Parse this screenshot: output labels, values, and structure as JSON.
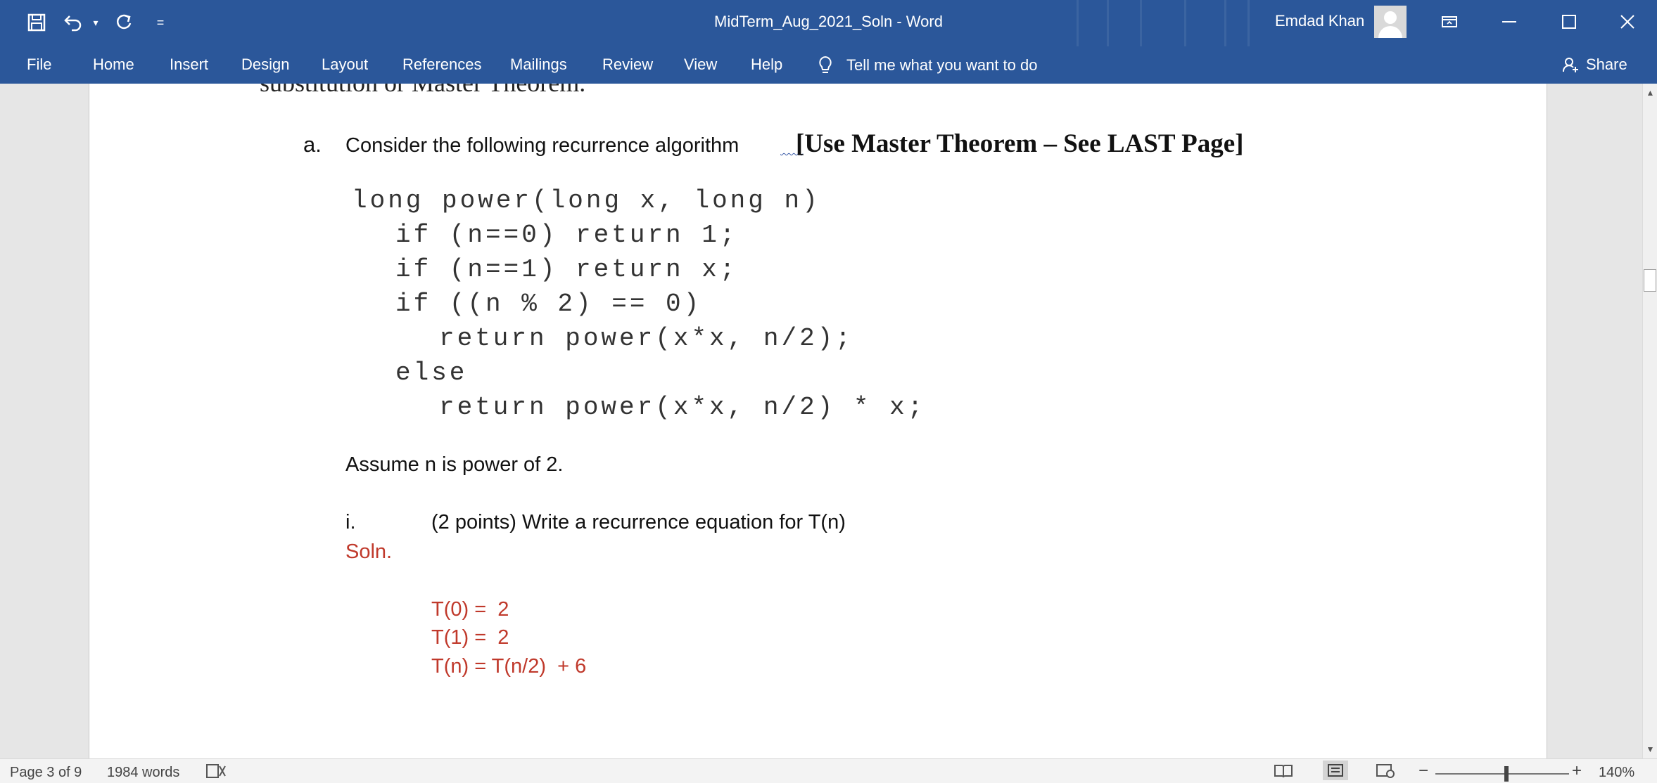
{
  "window": {
    "title": "MidTerm_Aug_2021_Soln  -  Word",
    "user_name": "Emdad Khan",
    "qat_more": "="
  },
  "ribbon": {
    "tabs": [
      "File",
      "Home",
      "Insert",
      "Design",
      "Layout",
      "References",
      "Mailings",
      "Review",
      "View",
      "Help"
    ],
    "tell_me": "Tell me what you want to do",
    "share": "Share"
  },
  "document": {
    "partial_top_line": "substitution or Master Theorem.",
    "item_marker": "a.",
    "item_text": "Consider the following recurrence algorithm",
    "item_bold": "[Use Master Theorem – See LAST Page]",
    "code_lines": [
      "long power(long x, long n)",
      "if (n==0) return 1;",
      "if (n==1) return x;",
      "if ((n % 2) == 0)",
      "return power(x*x, n/2);",
      "else",
      "return power(x*x, n/2) * x;"
    ],
    "assume": "Assume n is power of 2.",
    "sub_marker": "i.",
    "sub_text": "(2 points) Write a recurrence equation for T(n)",
    "soln_label": "Soln.",
    "eq1": "T(0) =  2",
    "eq2": "T(1) =  2",
    "eq3": "T(n) = T(n/2)  + 6"
  },
  "status": {
    "page": "Page 3 of 9",
    "words": "1984 words",
    "zoom_minus": "−",
    "zoom_plus": "+",
    "zoom": "140%"
  },
  "colors": {
    "accent": "#2b579a",
    "answer_red": "#c0392b"
  }
}
